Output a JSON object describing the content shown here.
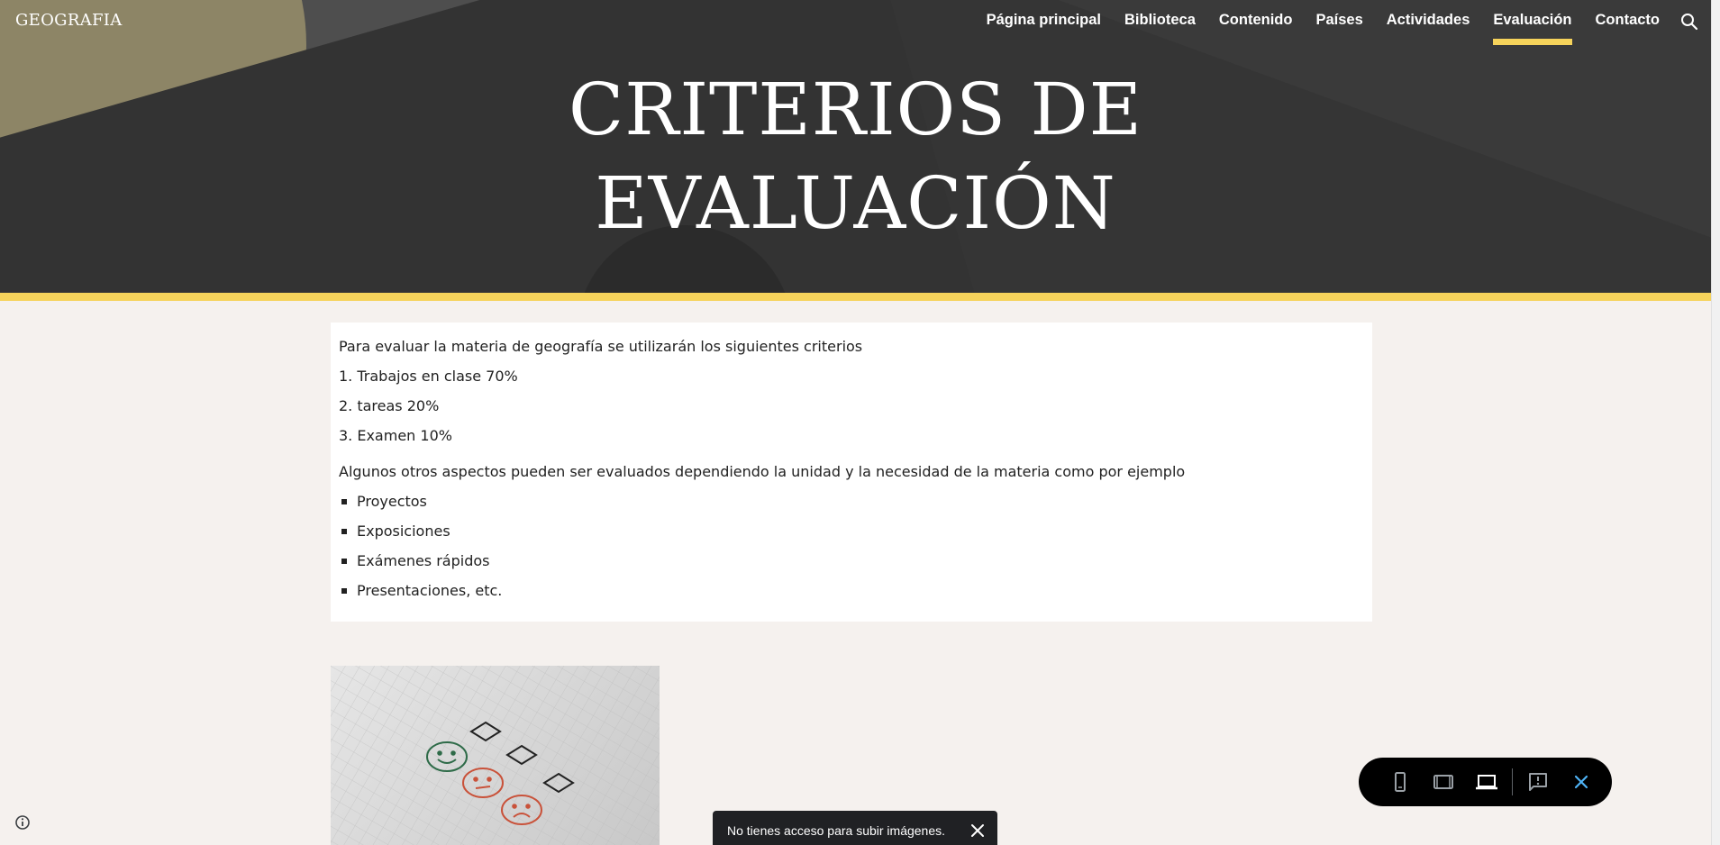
{
  "site": {
    "title": "GEOGRAFIA"
  },
  "nav": {
    "items": [
      {
        "label": "Página principal",
        "active": false
      },
      {
        "label": "Biblioteca",
        "active": false
      },
      {
        "label": "Contenido",
        "active": false
      },
      {
        "label": "Países",
        "active": false
      },
      {
        "label": "Actividades",
        "active": false
      },
      {
        "label": "Evaluación",
        "active": true
      },
      {
        "label": "Contacto",
        "active": false
      }
    ],
    "search_icon": "search-icon"
  },
  "hero": {
    "title_line1": "CRITERIOS DE",
    "title_line2": "EVALUACIÓN",
    "accent_color": "#f6d35b"
  },
  "content": {
    "intro": "Para evaluar la materia de geografía se utilizarán los siguientes criterios",
    "criteria": [
      "1. Trabajos en clase 70%",
      "2. tareas 20%",
      "3. Examen 10%"
    ],
    "other_intro": "Algunos otros aspectos pueden ser evaluados dependiendo la unidad y la necesidad de la materia como por ejemplo",
    "other_items": [
      "Proyectos",
      "Exposiciones",
      "Exámenes rápidos",
      "Presentaciones, etc."
    ]
  },
  "toolbar": {
    "icons": [
      "phone-icon",
      "tablet-icon",
      "laptop-icon",
      "report-icon",
      "close-icon"
    ],
    "active": "laptop-icon",
    "close_color": "#4fb3f5"
  },
  "toast": {
    "message": "No tienes acceso para subir imágenes."
  }
}
